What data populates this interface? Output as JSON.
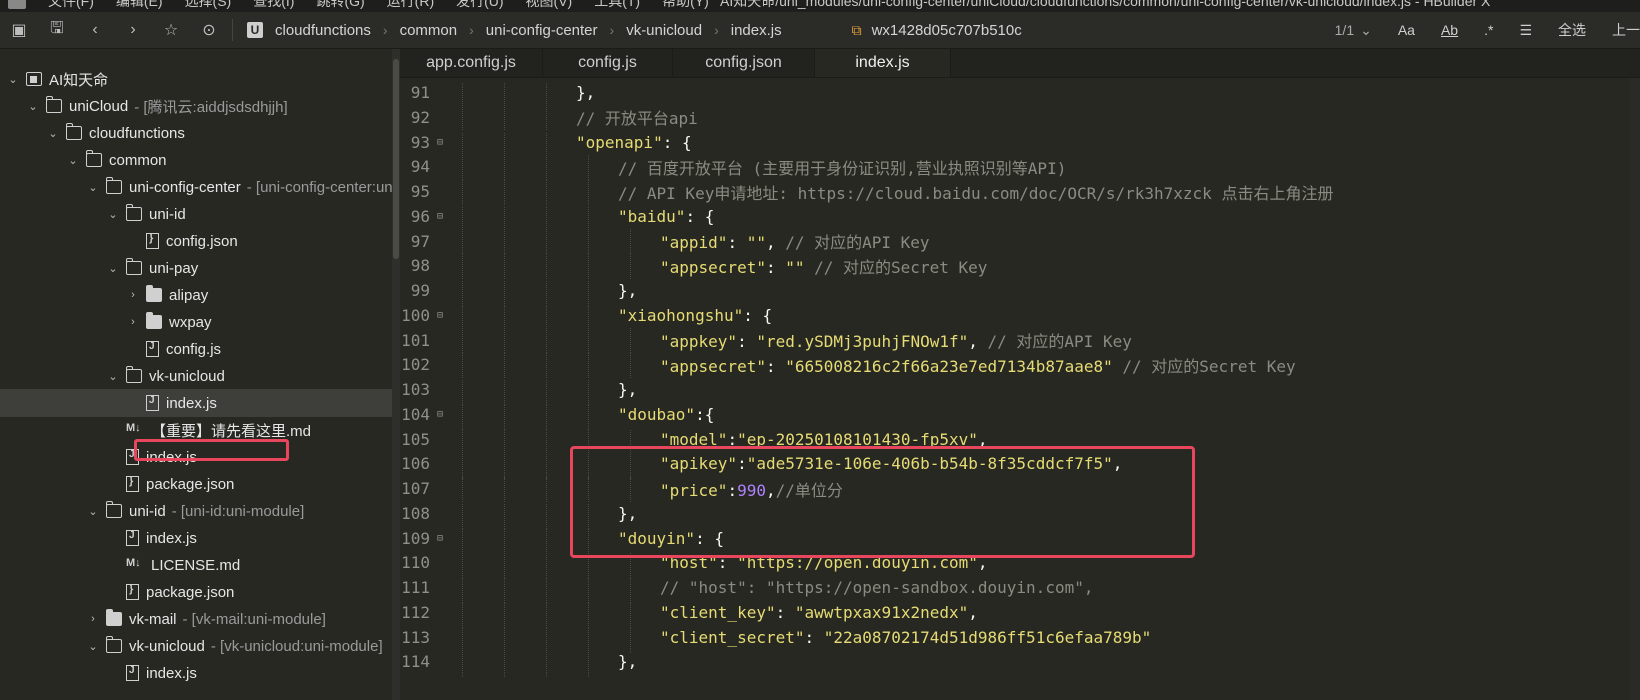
{
  "window": {
    "menu_partial": [
      "文件(F)",
      "编辑(E)",
      "选择(S)",
      "查找(I)",
      "跳转(G)",
      "运行(R)",
      "发行(U)",
      "视图(V)",
      "工具(T)",
      "帮助(Y)"
    ],
    "title_partial": "AI知天命/uni_modules/uni-config-center/uniCloud/cloudfunctions/common/uni-config-center/vk-unicloud/index.js - HBuilder X"
  },
  "toolbar": {
    "breadcrumb": [
      "cloudfunctions",
      "common",
      "uni-config-center",
      "vk-unicloud",
      "index.js"
    ],
    "wx_appid": "wx1428d05c707b510c",
    "page_indicator": "1/1",
    "select_all": "全选",
    "prev": "上一"
  },
  "sidebar": {
    "items": [
      {
        "label": "AI知天命",
        "meta": "",
        "depth": 0,
        "type": "project",
        "toggle": "open"
      },
      {
        "label": "uniCloud",
        "meta": "- [腾讯云:aiddjsdsdhjjh]",
        "depth": 1,
        "type": "folder-open",
        "toggle": "open"
      },
      {
        "label": "cloudfunctions",
        "meta": "",
        "depth": 2,
        "type": "folder-open",
        "toggle": "open"
      },
      {
        "label": "common",
        "meta": "",
        "depth": 3,
        "type": "folder-open",
        "toggle": "open"
      },
      {
        "label": "uni-config-center",
        "meta": "- [uni-config-center:uni-module]",
        "depth": 4,
        "type": "folder-open",
        "toggle": "open"
      },
      {
        "label": "uni-id",
        "meta": "",
        "depth": 5,
        "type": "folder-open",
        "toggle": "open"
      },
      {
        "label": "config.json",
        "meta": "",
        "depth": 6,
        "type": "json",
        "toggle": ""
      },
      {
        "label": "uni-pay",
        "meta": "",
        "depth": 5,
        "type": "folder-open",
        "toggle": "open"
      },
      {
        "label": "alipay",
        "meta": "",
        "depth": 6,
        "type": "folder-closed",
        "toggle": "closed"
      },
      {
        "label": "wxpay",
        "meta": "",
        "depth": 6,
        "type": "folder-closed",
        "toggle": "closed"
      },
      {
        "label": "config.js",
        "meta": "",
        "depth": 6,
        "type": "js",
        "toggle": ""
      },
      {
        "label": "vk-unicloud",
        "meta": "",
        "depth": 5,
        "type": "folder-open",
        "toggle": "open"
      },
      {
        "label": "index.js",
        "meta": "",
        "depth": 6,
        "type": "js",
        "toggle": "",
        "selected": true
      },
      {
        "label": "【重要】请先看这里.md",
        "meta": "",
        "depth": 5,
        "type": "md",
        "toggle": ""
      },
      {
        "label": "index.js",
        "meta": "",
        "depth": 5,
        "type": "js",
        "toggle": ""
      },
      {
        "label": "package.json",
        "meta": "",
        "depth": 5,
        "type": "json",
        "toggle": ""
      },
      {
        "label": "uni-id",
        "meta": "- [uni-id:uni-module]",
        "depth": 4,
        "type": "folder-open",
        "toggle": "open"
      },
      {
        "label": "index.js",
        "meta": "",
        "depth": 5,
        "type": "js",
        "toggle": ""
      },
      {
        "label": "LICENSE.md",
        "meta": "",
        "depth": 5,
        "type": "md",
        "toggle": ""
      },
      {
        "label": "package.json",
        "meta": "",
        "depth": 5,
        "type": "json",
        "toggle": ""
      },
      {
        "label": "vk-mail",
        "meta": "- [vk-mail:uni-module]",
        "depth": 4,
        "type": "folder-closed",
        "toggle": "closed"
      },
      {
        "label": "vk-unicloud",
        "meta": "- [vk-unicloud:uni-module]",
        "depth": 4,
        "type": "folder-open",
        "toggle": "open"
      },
      {
        "label": "index.js",
        "meta": "",
        "depth": 5,
        "type": "js",
        "toggle": ""
      }
    ]
  },
  "editor": {
    "tabs": [
      {
        "label": "app.config.js",
        "active": false
      },
      {
        "label": "config.js",
        "active": false
      },
      {
        "label": "config.json",
        "active": false
      },
      {
        "label": "index.js",
        "active": true
      }
    ],
    "lines": [
      {
        "num": "91",
        "fold": "",
        "indent": 3,
        "tokens": [
          [
            "p",
            "},"
          ]
        ]
      },
      {
        "num": "92",
        "fold": "",
        "indent": 3,
        "tokens": [
          [
            "c",
            "// 开放平台api"
          ]
        ]
      },
      {
        "num": "93",
        "fold": "⊟",
        "indent": 3,
        "tokens": [
          [
            "s",
            "\"openapi\""
          ],
          [
            "p",
            ": {"
          ]
        ]
      },
      {
        "num": "94",
        "fold": "",
        "indent": 4,
        "tokens": [
          [
            "c",
            "// 百度开放平台 (主要用于身份证识别,营业执照识别等API)"
          ]
        ]
      },
      {
        "num": "95",
        "fold": "",
        "indent": 4,
        "tokens": [
          [
            "c",
            "// API Key申请地址: https://cloud.baidu.com/doc/OCR/s/rk3h7xzck 点击右上角注册"
          ]
        ]
      },
      {
        "num": "96",
        "fold": "⊟",
        "indent": 4,
        "tokens": [
          [
            "s",
            "\"baidu\""
          ],
          [
            "p",
            ": {"
          ]
        ]
      },
      {
        "num": "97",
        "fold": "",
        "indent": 5,
        "tokens": [
          [
            "s",
            "\"appid\""
          ],
          [
            "p",
            ": "
          ],
          [
            "s",
            "\"\""
          ],
          [
            "p",
            ", "
          ],
          [
            "c",
            "// 对应的API Key"
          ]
        ]
      },
      {
        "num": "98",
        "fold": "",
        "indent": 5,
        "tokens": [
          [
            "s",
            "\"appsecret\""
          ],
          [
            "p",
            ": "
          ],
          [
            "s",
            "\"\""
          ],
          [
            "p",
            " "
          ],
          [
            "c",
            "// 对应的Secret Key"
          ]
        ]
      },
      {
        "num": "99",
        "fold": "",
        "indent": 4,
        "tokens": [
          [
            "p",
            "},"
          ]
        ]
      },
      {
        "num": "100",
        "fold": "⊟",
        "indent": 4,
        "tokens": [
          [
            "s",
            "\"xiaohongshu\""
          ],
          [
            "p",
            ": {"
          ]
        ]
      },
      {
        "num": "101",
        "fold": "",
        "indent": 5,
        "tokens": [
          [
            "s",
            "\"appkey\""
          ],
          [
            "p",
            ": "
          ],
          [
            "s",
            "\"red.ySDMj3puhjFNOw1f\""
          ],
          [
            "p",
            ", "
          ],
          [
            "c",
            "// 对应的API Key"
          ]
        ]
      },
      {
        "num": "102",
        "fold": "",
        "indent": 5,
        "tokens": [
          [
            "s",
            "\"appsecret\""
          ],
          [
            "p",
            ": "
          ],
          [
            "s",
            "\"665008216c2f66a23e7ed7134b87aae8\""
          ],
          [
            "p",
            " "
          ],
          [
            "c",
            "// 对应的Secret Key"
          ]
        ]
      },
      {
        "num": "103",
        "fold": "",
        "indent": 4,
        "tokens": [
          [
            "p",
            "},"
          ]
        ]
      },
      {
        "num": "104",
        "fold": "⊟",
        "indent": 4,
        "tokens": [
          [
            "s",
            "\"doubao\""
          ],
          [
            "p",
            ":{"
          ]
        ]
      },
      {
        "num": "105",
        "fold": "",
        "indent": 5,
        "tokens": [
          [
            "s",
            "\"model\""
          ],
          [
            "p",
            ":"
          ],
          [
            "s",
            "\"ep-20250108101430-fp5xv\""
          ],
          [
            "p",
            ","
          ]
        ]
      },
      {
        "num": "106",
        "fold": "",
        "indent": 5,
        "tokens": [
          [
            "s",
            "\"apikey\""
          ],
          [
            "p",
            ":"
          ],
          [
            "s",
            "\"ade5731e-106e-406b-b54b-8f35cddcf7f5\""
          ],
          [
            "p",
            ","
          ]
        ]
      },
      {
        "num": "107",
        "fold": "",
        "indent": 5,
        "tokens": [
          [
            "s",
            "\"price\""
          ],
          [
            "p",
            ":"
          ],
          [
            "n",
            "990"
          ],
          [
            "p",
            ","
          ],
          [
            "c",
            "//单位分"
          ]
        ]
      },
      {
        "num": "108",
        "fold": "",
        "indent": 4,
        "tokens": [
          [
            "p",
            "},"
          ]
        ]
      },
      {
        "num": "109",
        "fold": "⊟",
        "indent": 4,
        "tokens": [
          [
            "s",
            "\"douyin\""
          ],
          [
            "p",
            ": {"
          ]
        ]
      },
      {
        "num": "110",
        "fold": "",
        "indent": 5,
        "tokens": [
          [
            "s",
            "\"host\""
          ],
          [
            "p",
            ": "
          ],
          [
            "s",
            "\"https://open.douyin.com\""
          ],
          [
            "p",
            ","
          ]
        ]
      },
      {
        "num": "111",
        "fold": "",
        "indent": 5,
        "tokens": [
          [
            "c",
            "// \"host\": \"https://open-sandbox.douyin.com\","
          ]
        ]
      },
      {
        "num": "112",
        "fold": "",
        "indent": 5,
        "tokens": [
          [
            "s",
            "\"client_key\""
          ],
          [
            "p",
            ": "
          ],
          [
            "s",
            "\"awwtpxax91x2nedx\""
          ],
          [
            "p",
            ","
          ]
        ]
      },
      {
        "num": "113",
        "fold": "",
        "indent": 5,
        "tokens": [
          [
            "s",
            "\"client_secret\""
          ],
          [
            "p",
            ": "
          ],
          [
            "s",
            "\"22a08702174d51d986ff51c6efaa789b\""
          ]
        ]
      },
      {
        "num": "114",
        "fold": "",
        "indent": 4,
        "tokens": [
          [
            "p",
            "},"
          ]
        ]
      }
    ]
  },
  "colors": {
    "background": "#272822",
    "string": "#e6db74",
    "comment": "#8a8b82",
    "number": "#ae81ff",
    "highlight": "#e8465c"
  }
}
